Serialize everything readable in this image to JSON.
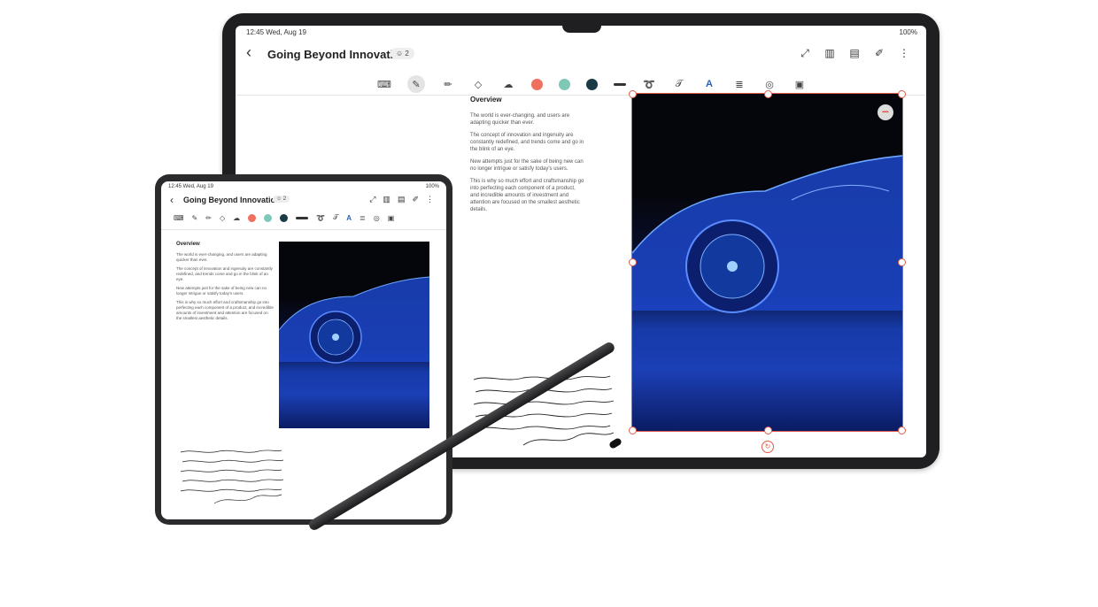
{
  "tablet": {
    "status": {
      "time": "12:45 Wed, Aug 19",
      "right": "100%"
    },
    "header": {
      "title": "Going Beyond Innovation",
      "collab": "2"
    },
    "document": {
      "heading": "Overview",
      "paragraphs": [
        "The world is ever-changing, and users are adapting quicker than ever.",
        "The concept of innovation and ingenuity are constantly redefined, and trends come and go in the blink of an eye.",
        "New attempts just for the sake of being new can no longer intrigue or satisfy today's users.",
        "This is why so much effort and craftsmanship go into perfecting each component of a product, and incredible amounts of investment and attention are focused on the smallest aesthetic details."
      ]
    },
    "colors": [
      "#f07060",
      "#7ec8b8",
      "#1a3a45"
    ]
  },
  "phone": {
    "status": {
      "time": "12:45 Wed, Aug 19",
      "right": "100%"
    },
    "header": {
      "title": "Going Beyond Innovation",
      "collab": "2"
    },
    "document": {
      "heading": "Overview",
      "paragraphs": [
        "The world is ever-changing, and users are adapting quicker than ever.",
        "The concept of innovation and ingenuity are constantly redefined, and trends come and go in the blink of an eye.",
        "New attempts just for the sake of being new can no longer intrigue or satisfy today's users.",
        "This is why so much effort and craftsmanship go into perfecting each component of a product, and incredible amounts of investment and attention are focused on the smallest aesthetic details."
      ]
    }
  }
}
